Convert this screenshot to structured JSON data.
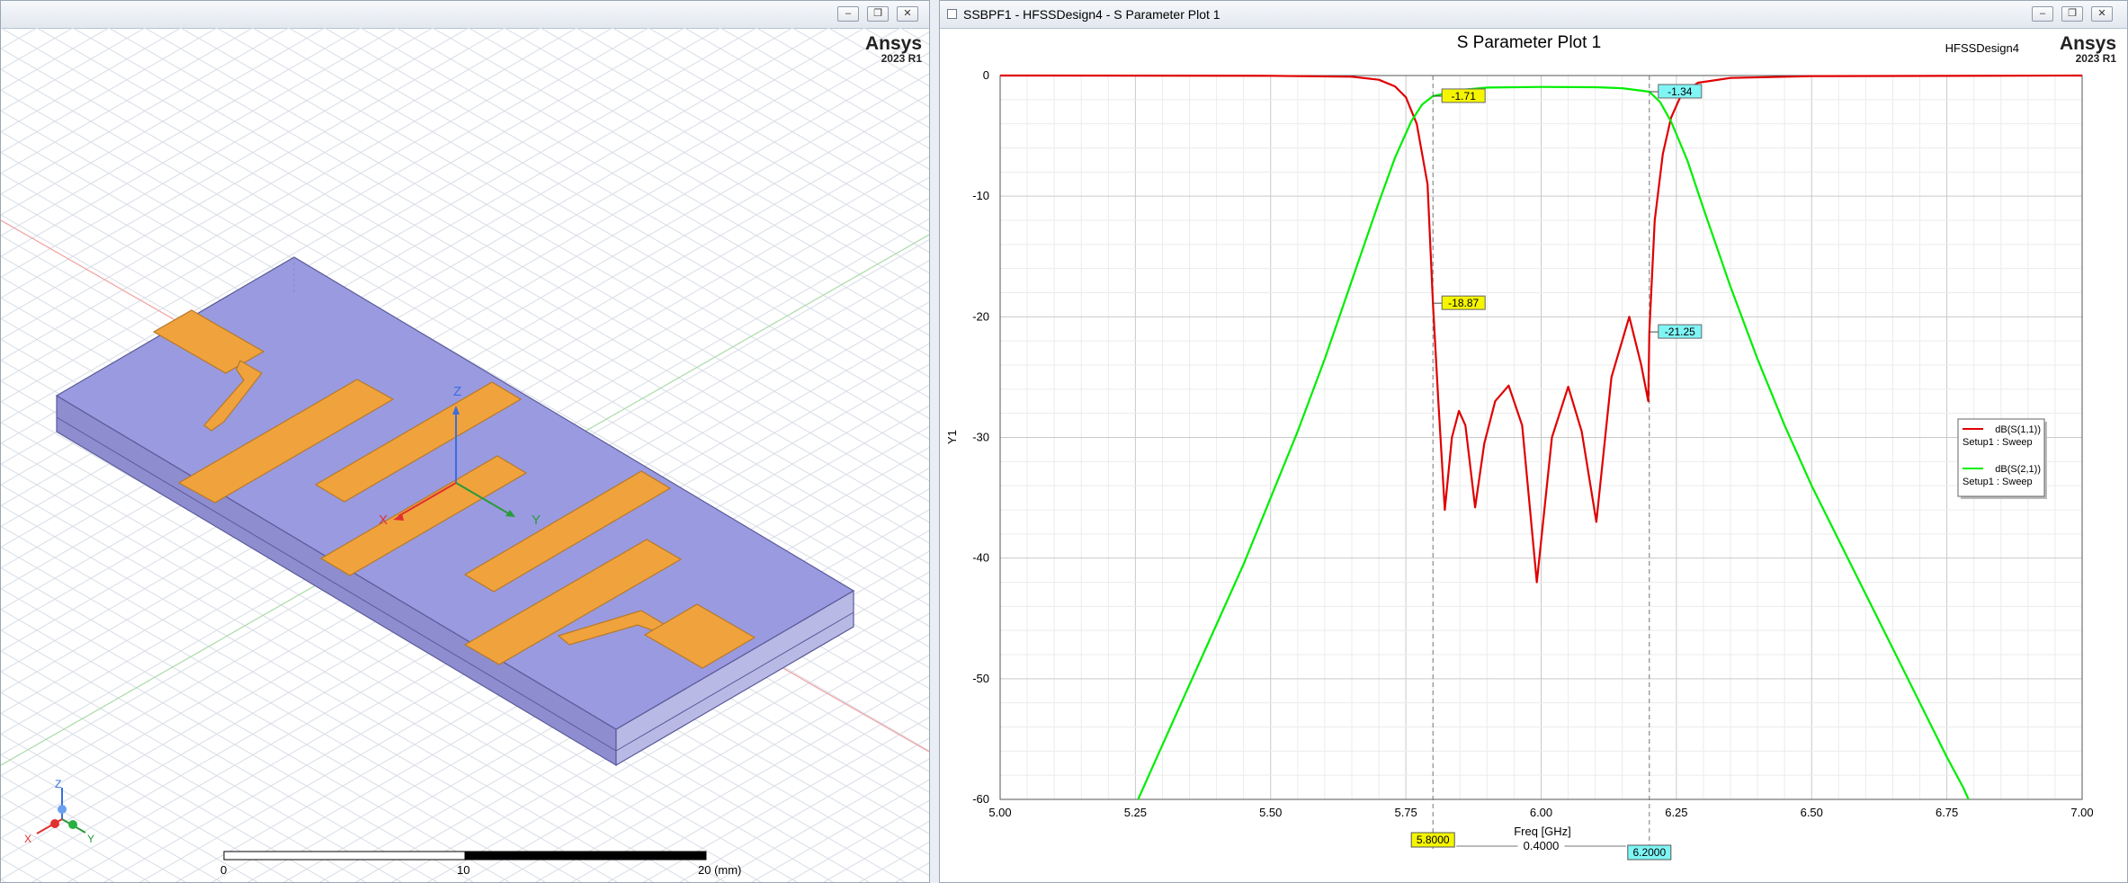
{
  "left_window": {
    "title": "",
    "brand": "Ansys",
    "release": "2023 R1",
    "axes": {
      "x": "X",
      "y": "Y",
      "z": "Z"
    },
    "mini_axes": {
      "x": "X",
      "y": "Y",
      "z": "Z"
    },
    "scale_bar": {
      "label_0": "0",
      "label_10": "10",
      "label_20": "20 (mm)"
    },
    "buttons": {
      "minimize": "–",
      "restore": "❐",
      "close": "✕"
    },
    "colors": {
      "substrate": "#9a9ae0",
      "metal": "#f0a23c",
      "background": "#ffffff"
    }
  },
  "right_window": {
    "title": "SSBPF1 - HFSSDesign4 - S Parameter Plot 1",
    "brand": "Ansys",
    "release": "2023 R1",
    "design_label": "HFSSDesign4",
    "buttons": {
      "minimize": "–",
      "restore": "❐",
      "close": "✕"
    }
  },
  "chart_data": {
    "type": "line",
    "title": "S Parameter Plot 1",
    "xlabel": "Freq [GHz]",
    "ylabel": "Y1",
    "xlim": [
      5.0,
      7.0
    ],
    "ylim": [
      -60,
      0
    ],
    "xticks": [
      "5.00",
      "5.25",
      "5.50",
      "5.75",
      "6.00",
      "6.25",
      "6.50",
      "6.75",
      "7.00"
    ],
    "yticks": [
      "0",
      "-10",
      "-20",
      "-30",
      "-40",
      "-50",
      "-60"
    ],
    "grid": true,
    "legend_position": "right",
    "series": [
      {
        "name": "dB(S(1,1))",
        "sub": "Setup1 : Sweep",
        "color": "#e00000",
        "points": [
          [
            5.0,
            0
          ],
          [
            5.5,
            -0.02
          ],
          [
            5.65,
            -0.1
          ],
          [
            5.7,
            -0.35
          ],
          [
            5.73,
            -0.9
          ],
          [
            5.75,
            -1.8
          ],
          [
            5.77,
            -4.0
          ],
          [
            5.79,
            -9.0
          ],
          [
            5.8,
            -18.87
          ],
          [
            5.81,
            -27.0
          ],
          [
            5.822,
            -36.0
          ],
          [
            5.835,
            -30.0
          ],
          [
            5.848,
            -27.8
          ],
          [
            5.86,
            -29.0
          ],
          [
            5.878,
            -35.8
          ],
          [
            5.895,
            -30.5
          ],
          [
            5.915,
            -27.0
          ],
          [
            5.94,
            -25.7
          ],
          [
            5.965,
            -29.0
          ],
          [
            5.992,
            -42.0
          ],
          [
            6.02,
            -30.0
          ],
          [
            6.05,
            -25.8
          ],
          [
            6.075,
            -29.5
          ],
          [
            6.102,
            -37.0
          ],
          [
            6.13,
            -25.0
          ],
          [
            6.163,
            -20.0
          ],
          [
            6.185,
            -24.0
          ],
          [
            6.198,
            -27.0
          ],
          [
            6.2,
            -21.25
          ],
          [
            6.21,
            -12.0
          ],
          [
            6.225,
            -6.5
          ],
          [
            6.24,
            -3.5
          ],
          [
            6.26,
            -1.5
          ],
          [
            6.29,
            -0.6
          ],
          [
            6.35,
            -0.2
          ],
          [
            6.5,
            -0.05
          ],
          [
            7.0,
            0
          ]
        ],
        "markers": [
          [
            5.8,
            -18.87,
            "-18.87"
          ],
          [
            6.2,
            -21.25,
            "-21.25"
          ]
        ]
      },
      {
        "name": "dB(S(2,1))",
        "sub": "Setup1 : Sweep",
        "color": "#00ee00",
        "points": [
          [
            5.255,
            -60
          ],
          [
            5.3,
            -55.5
          ],
          [
            5.35,
            -50.5
          ],
          [
            5.4,
            -45.5
          ],
          [
            5.45,
            -40.5
          ],
          [
            5.5,
            -35.0
          ],
          [
            5.55,
            -29.5
          ],
          [
            5.6,
            -23.5
          ],
          [
            5.65,
            -17.0
          ],
          [
            5.7,
            -10.5
          ],
          [
            5.73,
            -6.8
          ],
          [
            5.76,
            -3.8
          ],
          [
            5.78,
            -2.4
          ],
          [
            5.8,
            -1.71
          ],
          [
            5.85,
            -1.2
          ],
          [
            5.9,
            -1.0
          ],
          [
            6.0,
            -0.95
          ],
          [
            6.1,
            -0.97
          ],
          [
            6.15,
            -1.05
          ],
          [
            6.2,
            -1.34
          ],
          [
            6.22,
            -2.2
          ],
          [
            6.24,
            -3.8
          ],
          [
            6.27,
            -7.0
          ],
          [
            6.3,
            -11.0
          ],
          [
            6.35,
            -17.5
          ],
          [
            6.4,
            -23.5
          ],
          [
            6.45,
            -29.0
          ],
          [
            6.5,
            -34.0
          ],
          [
            6.55,
            -38.5
          ],
          [
            6.6,
            -43.0
          ],
          [
            6.65,
            -47.5
          ],
          [
            6.7,
            -52.0
          ],
          [
            6.75,
            -56.5
          ],
          [
            6.78,
            -59.0
          ],
          [
            6.79,
            -60
          ]
        ],
        "markers": [
          [
            5.8,
            -1.71,
            "-1.71"
          ],
          [
            6.2,
            -1.34,
            "-1.34"
          ]
        ]
      }
    ],
    "vertical_markers": [
      {
        "x": 5.8,
        "label": "5.8000",
        "color": "#f5f500"
      },
      {
        "x": 6.2,
        "label": "6.2000",
        "color": "#7ff5f5"
      }
    ],
    "delta_label": "0.4000"
  }
}
